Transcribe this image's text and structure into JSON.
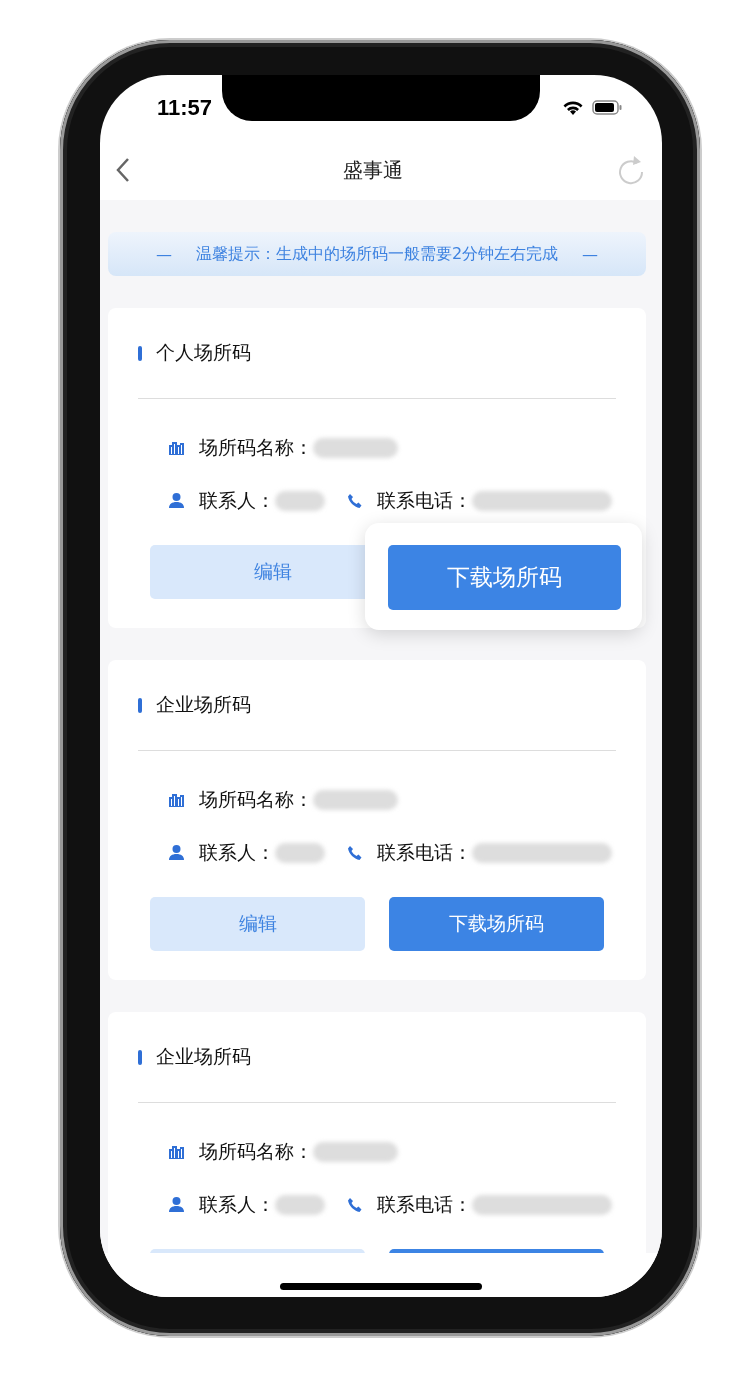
{
  "status_bar": {
    "time": "11:57"
  },
  "nav": {
    "title": "盛事通"
  },
  "notice": {
    "text": "温馨提示：生成中的场所码一般需要2分钟左右完成",
    "dash_left": "—",
    "dash_right": "—"
  },
  "cards": [
    {
      "title": "个人场所码",
      "name_label": "场所码名称：",
      "contact_label": "联系人：",
      "phone_label": "联系电话：",
      "buttons": [
        {
          "kind": "secondary",
          "label": "编辑",
          "highlighted": false
        },
        {
          "kind": "primary",
          "label": "下载场所码",
          "highlighted": true
        }
      ]
    },
    {
      "title": "企业场所码",
      "name_label": "场所码名称：",
      "contact_label": "联系人：",
      "phone_label": "联系电话：",
      "buttons": [
        {
          "kind": "secondary",
          "label": "编辑",
          "highlighted": false
        },
        {
          "kind": "primary",
          "label": "下载场所码",
          "highlighted": false
        }
      ]
    },
    {
      "title": "企业场所码",
      "name_label": "场所码名称：",
      "contact_label": "联系人：",
      "phone_label": "联系电话：",
      "buttons": [
        {
          "kind": "secondary",
          "highlighted": false
        },
        {
          "kind": "primary",
          "highlighted": false
        }
      ]
    }
  ]
}
